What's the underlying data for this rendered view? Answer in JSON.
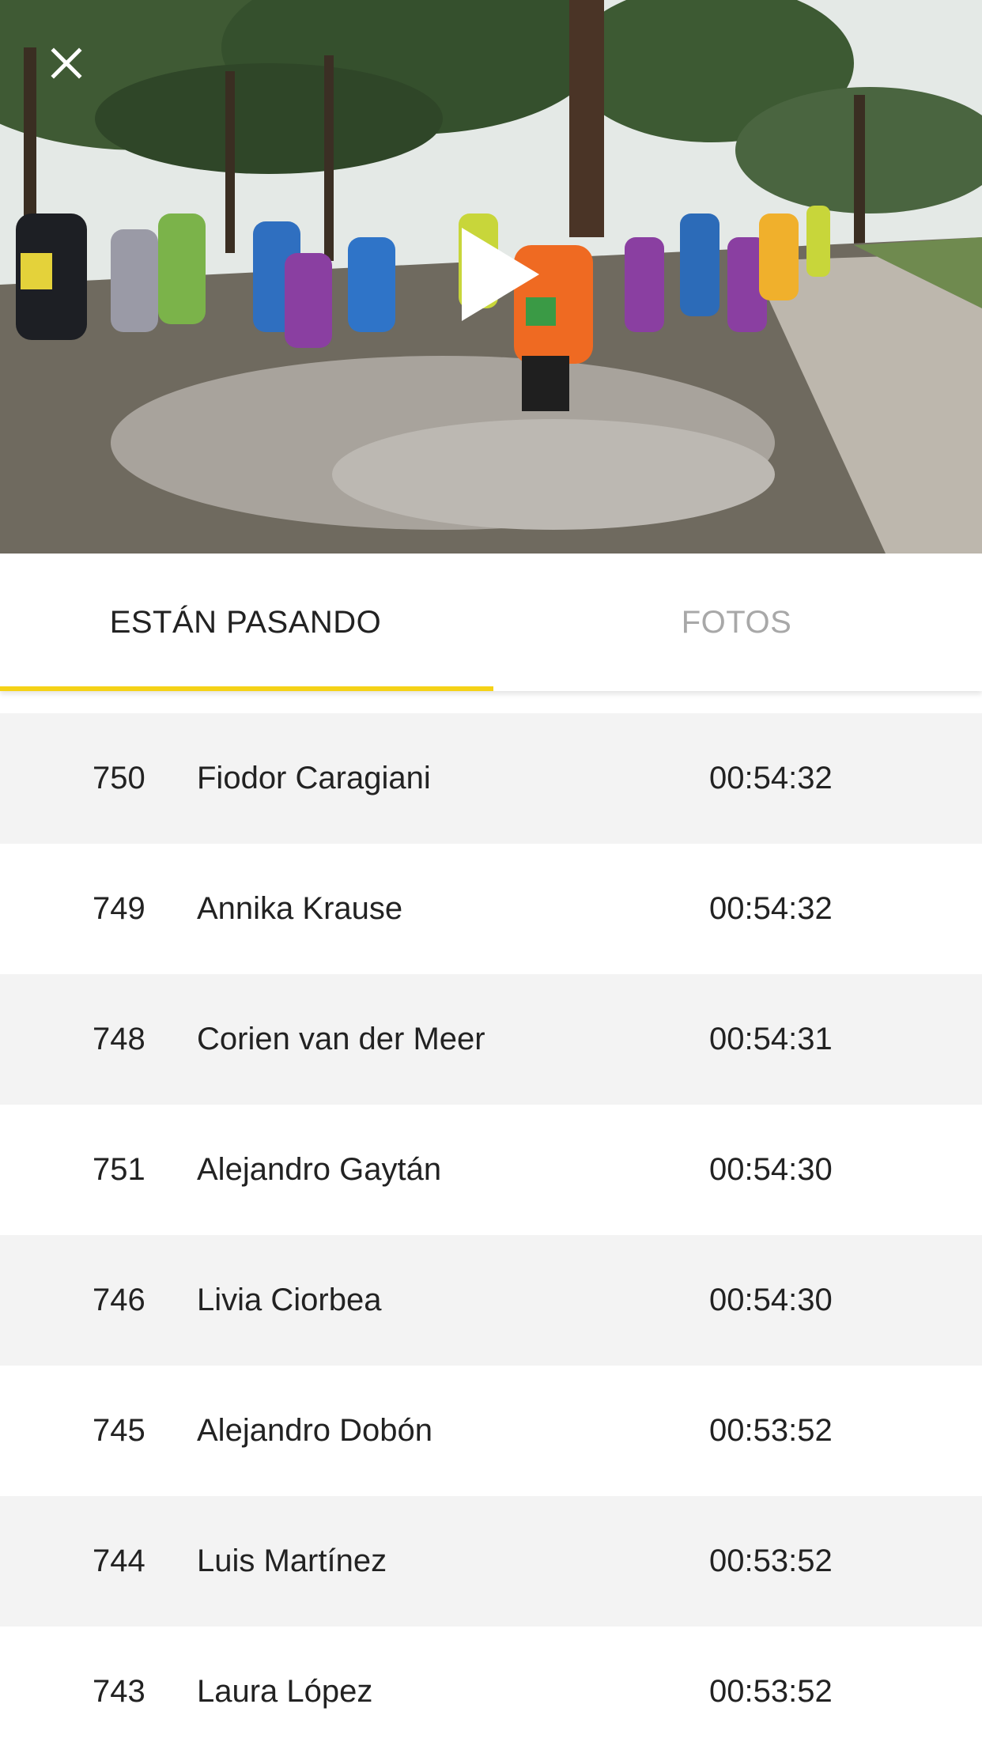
{
  "tabs": [
    {
      "label": "ESTÁN PASANDO",
      "active": true
    },
    {
      "label": "FOTOS",
      "active": false
    }
  ],
  "colors": {
    "accent": "#f5d216",
    "row_alt": "#f3f3f3",
    "text": "#222222",
    "tab_inactive": "#a8a8a8"
  },
  "video": {
    "close_icon": "close-icon",
    "play_icon": "play-icon"
  },
  "runners": [
    {
      "bib": "750",
      "name": "Fiodor Caragiani",
      "time": "00:54:32"
    },
    {
      "bib": "749",
      "name": "Annika Krause",
      "time": "00:54:32"
    },
    {
      "bib": "748",
      "name": "Corien van der Meer",
      "time": "00:54:31"
    },
    {
      "bib": "751",
      "name": "Alejandro Gaytán",
      "time": "00:54:30"
    },
    {
      "bib": "746",
      "name": "Livia Ciorbea",
      "time": "00:54:30"
    },
    {
      "bib": "745",
      "name": "Alejandro Dobón",
      "time": "00:53:52"
    },
    {
      "bib": "744",
      "name": "Luis Martínez",
      "time": "00:53:52"
    },
    {
      "bib": "743",
      "name": "Laura López",
      "time": "00:53:52"
    }
  ]
}
